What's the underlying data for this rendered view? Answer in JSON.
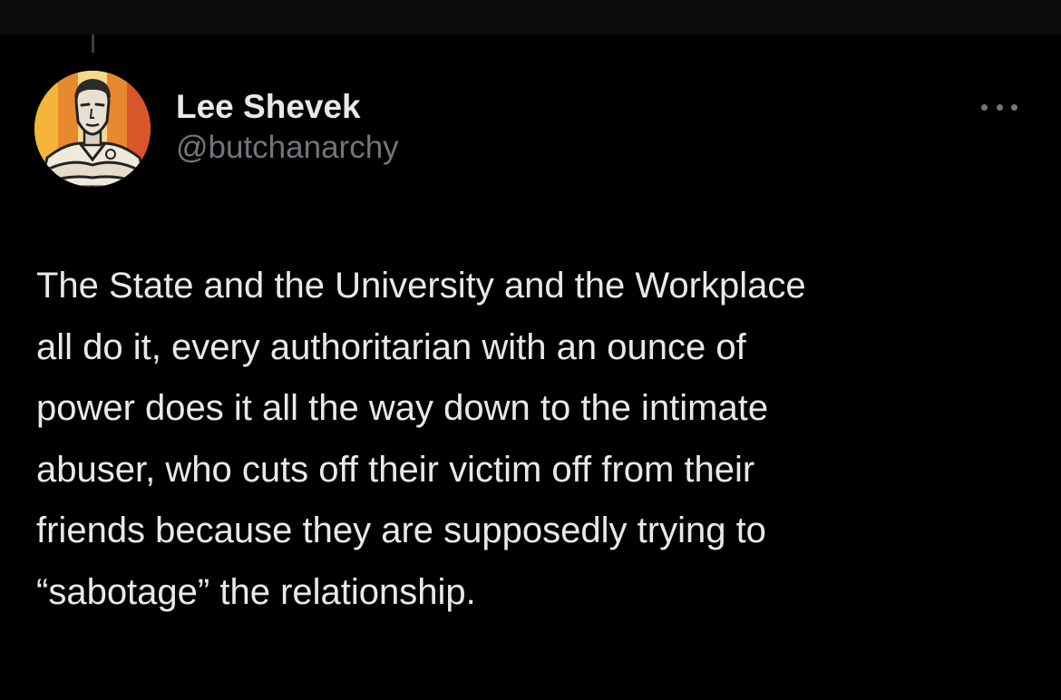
{
  "tweet": {
    "author": {
      "display_name": "Lee Shevek",
      "handle": "@butchanarchy",
      "avatar_icon": "illustrated-portrait-avatar"
    },
    "more_icon": "more-options-icon",
    "text": "The State and the University and the Workplace\nall do it, every authoritarian with an ounce of\npower does it all the way down to the intimate\nabuser, who cuts off their victim off from their\nfriends because they are supposedly trying to\n“sabotage” the relationship."
  },
  "colors": {
    "background": "#000000",
    "text_primary": "#e7e9ea",
    "text_secondary": "#71767b",
    "avatar_stripes": [
      "#f4b63a",
      "#e9892f",
      "#d9562b",
      "#f0c35a"
    ]
  }
}
